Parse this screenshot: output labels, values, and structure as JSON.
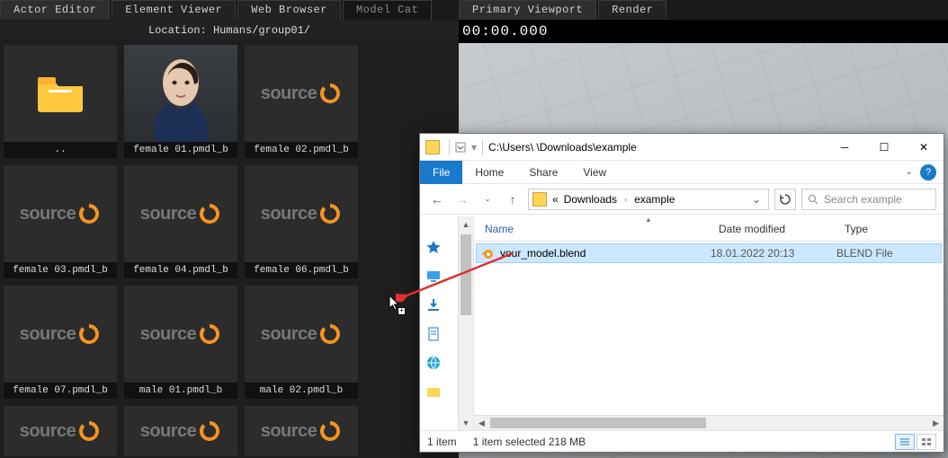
{
  "left": {
    "tabs": [
      "Actor Editor",
      "Element Viewer",
      "Web Browser",
      "Model Cat"
    ],
    "activeTab": 0,
    "location_label": "Location: ",
    "location_value": "Humans/group01/",
    "items": [
      {
        "label": "..",
        "type": "folder"
      },
      {
        "label": "female 01.pmdl_b",
        "type": "head"
      },
      {
        "label": "female 02.pmdl_b",
        "type": "source"
      },
      {
        "label": "female 03.pmdl_b",
        "type": "source"
      },
      {
        "label": "female 04.pmdl_b",
        "type": "source"
      },
      {
        "label": "female 06.pmdl_b",
        "type": "source"
      },
      {
        "label": "female 07.pmdl_b",
        "type": "source"
      },
      {
        "label": "male 01.pmdl_b",
        "type": "source"
      },
      {
        "label": "male 02.pmdl_b",
        "type": "source"
      }
    ]
  },
  "right": {
    "tabs": [
      "Primary Viewport",
      "Render"
    ],
    "activeTab": 0,
    "timecode": "00:00.000"
  },
  "explorer": {
    "title_path": "C:\\Users\\        \\Downloads\\example",
    "menu": {
      "file": "File",
      "home": "Home",
      "share": "Share",
      "view": "View"
    },
    "breadcrumb": {
      "prefix": "«",
      "parts": [
        "Downloads",
        "example"
      ]
    },
    "search_placeholder": "Search example",
    "columns": {
      "name": "Name",
      "date": "Date modified",
      "type": "Type"
    },
    "files": [
      {
        "name": "your_model.blend",
        "date": "18.01.2022 20:13",
        "type": "BLEND File"
      }
    ],
    "status": {
      "count": "1 item",
      "selected": "1 item selected  218 MB"
    }
  }
}
